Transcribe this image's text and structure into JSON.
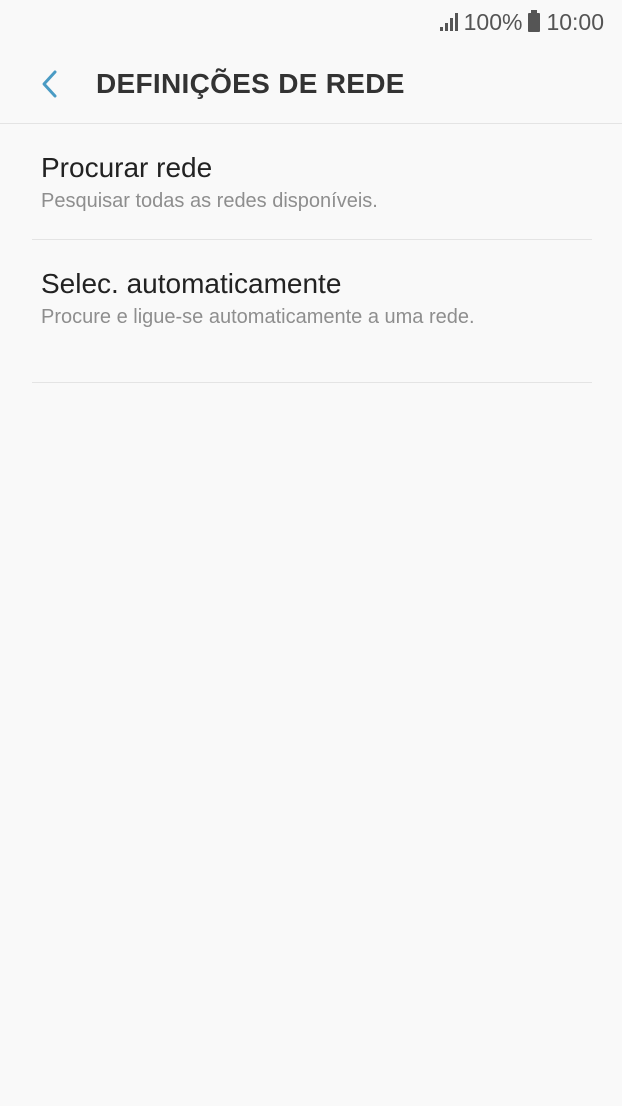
{
  "status_bar": {
    "battery": "100%",
    "time": "10:00",
    "signal_icon": "signal-icon",
    "battery_icon": "battery-icon"
  },
  "app_bar": {
    "back_icon": "chevron-left-icon",
    "title": "DEFINIÇÕES DE REDE",
    "accent_color": "#4a9bc4"
  },
  "items": [
    {
      "title": "Procurar rede",
      "subtitle": "Pesquisar todas as redes disponíveis."
    },
    {
      "title": "Selec. automaticamente",
      "subtitle": "Procure e ligue-se automaticamente a uma rede."
    }
  ]
}
